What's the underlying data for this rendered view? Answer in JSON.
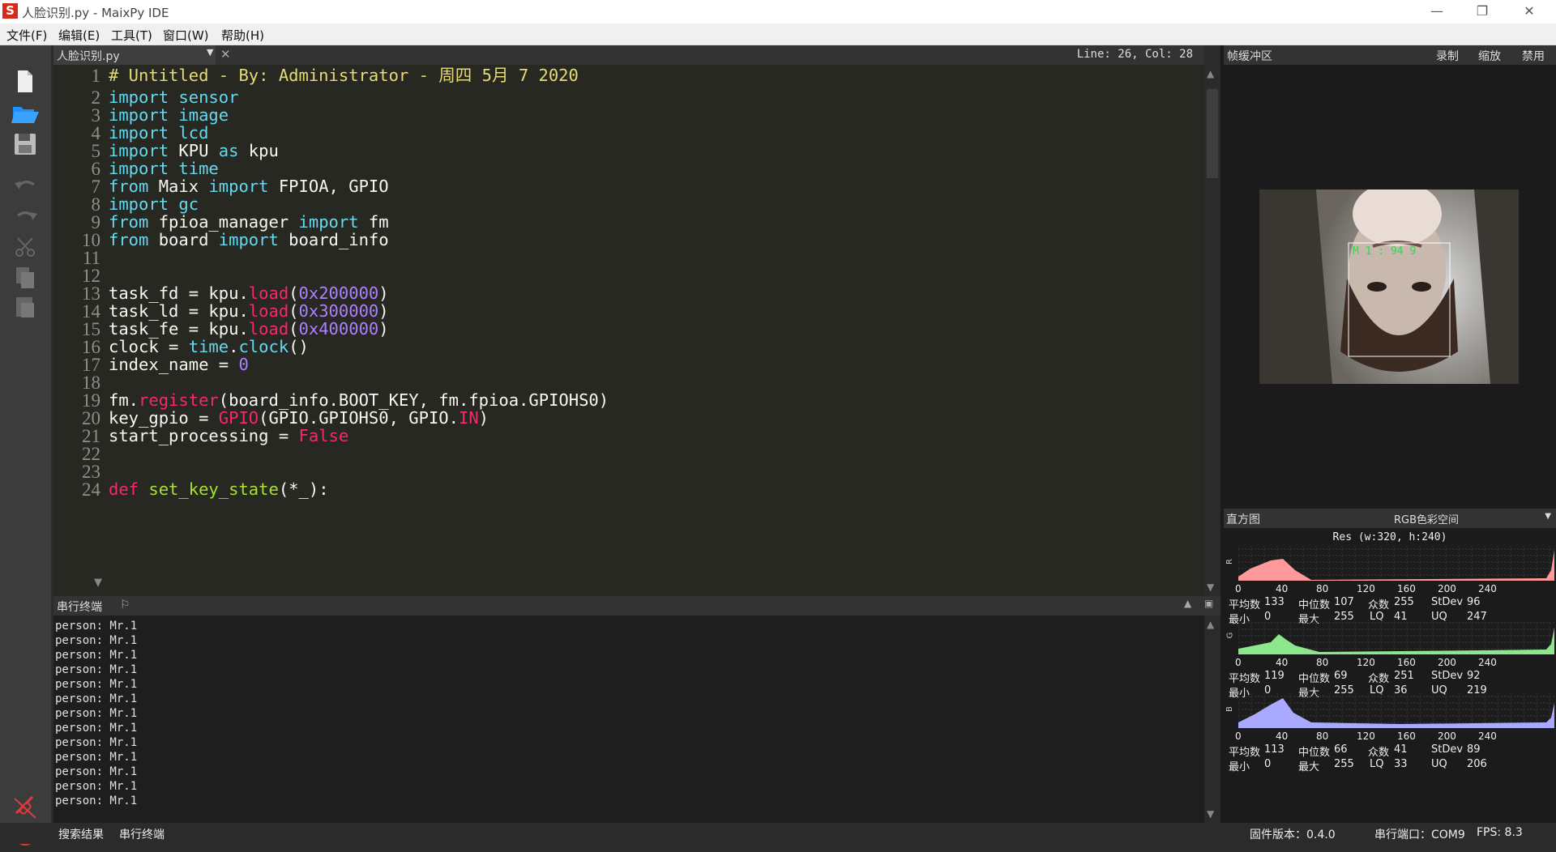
{
  "window": {
    "title": "人脸识别.py - MaixPy IDE",
    "logo": "S"
  },
  "menu": [
    "文件(F)",
    "编辑(E)",
    "工具(T)",
    "窗口(W)",
    "帮助(H)"
  ],
  "editor": {
    "tab": "人脸识别.py",
    "cursor": "Line: 26, Col: 28",
    "line_numbers": [
      "1",
      "2",
      "3",
      "4",
      "5",
      "6",
      "7",
      "8",
      "9",
      "10",
      "11",
      "12",
      "13",
      "14",
      "15",
      "16",
      "17",
      "18",
      "19",
      "20",
      "21",
      "22",
      "23",
      "24"
    ]
  },
  "terminal": {
    "label": "串行终端",
    "lines": [
      "person: Mr.1",
      "person: Mr.1",
      "person: Mr.1",
      "person: Mr.1",
      "person: Mr.1",
      "person: Mr.1",
      "person: Mr.1",
      "person: Mr.1",
      "person: Mr.1",
      "person: Mr.1",
      "person: Mr.1",
      "person: Mr.1",
      "person: Mr.1"
    ]
  },
  "framebuffer": {
    "title": "帧缓冲区",
    "record": "录制",
    "zoom": "缩放",
    "disable": "禁用",
    "overlay_text": "M 1  :  94 9"
  },
  "histogram": {
    "title": "直方图",
    "colorspace": "RGB色彩空间",
    "res": "Res (w:320, h:240)",
    "ticks": [
      "0",
      "40",
      "80",
      "120",
      "160",
      "200",
      "240"
    ],
    "labels": {
      "mean": "平均数",
      "median": "中位数",
      "mode": "众数",
      "stdev": "StDev",
      "min": "最小",
      "max": "最大",
      "lq": "LQ",
      "uq": "UQ"
    },
    "channels": [
      {
        "name": "R",
        "color": "#ff9a9a",
        "mean": "133",
        "median": "107",
        "mode": "255",
        "stdev": "96",
        "min": "0",
        "max": "255",
        "lq": "41",
        "uq": "247"
      },
      {
        "name": "G",
        "color": "#8ce68c",
        "mean": "119",
        "median": "69",
        "mode": "251",
        "stdev": "92",
        "min": "0",
        "max": "255",
        "lq": "36",
        "uq": "219"
      },
      {
        "name": "B",
        "color": "#a9a9ff",
        "mean": "113",
        "median": "66",
        "mode": "41",
        "stdev": "89",
        "min": "0",
        "max": "255",
        "lq": "33",
        "uq": "206"
      }
    ]
  },
  "status": {
    "tab_search": "搜索结果",
    "tab_serial": "串行终端",
    "firmware": "固件版本：0.4.0",
    "port": "串行端口：COM9",
    "fps": "FPS:  8.3"
  },
  "colors": {
    "editor_bg": "#272822",
    "sidebar_bg": "#3c3c3c",
    "panel_bg": "#1b1b1b",
    "comment": "#e6db74",
    "keyword": "#66d9ef",
    "number": "#ae81ff",
    "function": "#f92672"
  }
}
